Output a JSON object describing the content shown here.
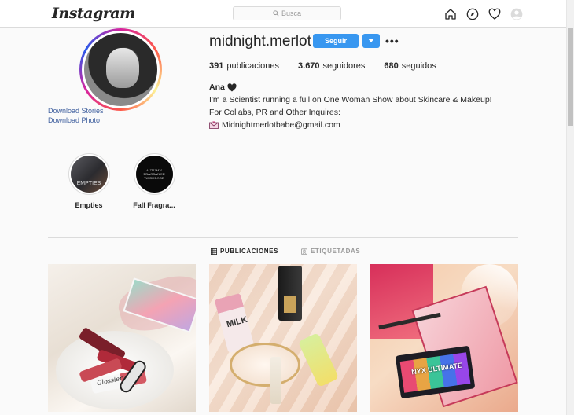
{
  "nav": {
    "logo": "Instagram",
    "search_placeholder": "Busca",
    "icons": [
      "home-icon",
      "explore-compass-icon",
      "activity-heart-icon",
      "profile-avatar-icon"
    ]
  },
  "profile": {
    "username": "midnight.merlot",
    "follow_label": "Seguir",
    "download_stories": "Download Stories",
    "download_photo": "Download Photo",
    "stats": {
      "posts_count": "391",
      "posts_label": "publicaciones",
      "followers_count": "3.670",
      "followers_label": "seguidores",
      "following_count": "680",
      "following_label": "seguidos"
    },
    "bio": {
      "name": "Ana",
      "line1": "I'm a Scientist running a full on One Woman Show about Skincare & Makeup!",
      "line2": "For Collabs, PR and Other Inquires:",
      "email": "Midnightmerlotbabe@gmail.com"
    }
  },
  "highlights": [
    {
      "label": "Empties",
      "cover_text": "EMPTIES"
    },
    {
      "label": "Fall Fragra...",
      "cover_text": "AUTUMN FRAGRANCE WARDROBE"
    }
  ],
  "tabs": {
    "posts": "PUBLICACIONES",
    "tagged": "ETIQUETADAS"
  },
  "posts": [
    {
      "label": "Glossier"
    },
    {
      "label": "MILK"
    },
    {
      "label": "NYX ULTIMATE"
    }
  ],
  "colors": {
    "accent": "#3897f0",
    "link": "#3f5f9e",
    "text": "#262626",
    "muted": "#999999",
    "border": "#dbdbdb"
  }
}
